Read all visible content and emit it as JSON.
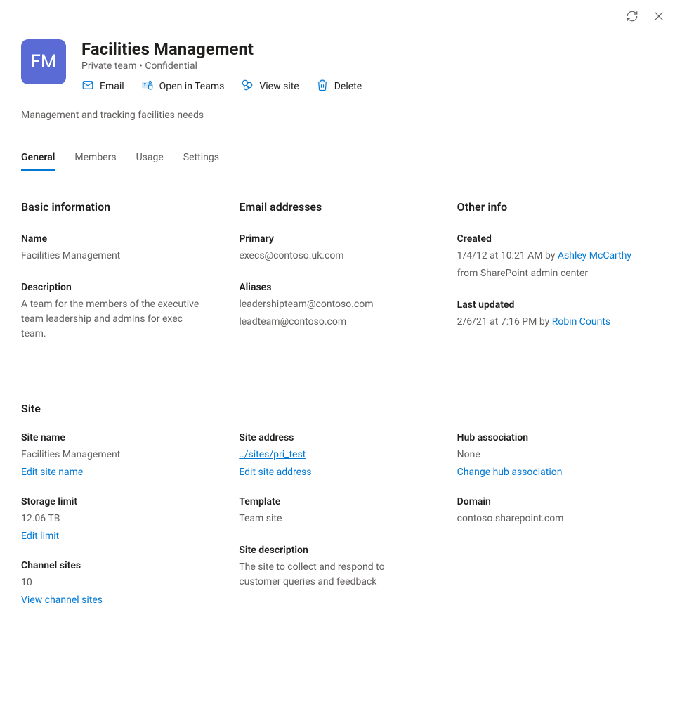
{
  "header": {
    "avatar_initials": "FM",
    "title": "Facilities Management",
    "subtitle": "Private team • Confidential",
    "actions": {
      "email": "Email",
      "open_in_teams": "Open in Teams",
      "view_site": "View site",
      "delete": "Delete"
    },
    "description": "Management and tracking facilities needs"
  },
  "tabs": [
    "General",
    "Members",
    "Usage",
    "Settings"
  ],
  "sections": {
    "basic": {
      "heading": "Basic information",
      "name_label": "Name",
      "name_value": "Facilities Management",
      "desc_label": "Description",
      "desc_value": "A team for the members of the executive team leadership and admins for exec team."
    },
    "email": {
      "heading": "Email addresses",
      "primary_label": "Primary",
      "primary_value": "execs@contoso.uk.com",
      "aliases_label": "Aliases",
      "alias1": "leadershipteam@contoso.com",
      "alias2": "leadteam@contoso.com"
    },
    "other": {
      "heading": "Other info",
      "created_label": "Created",
      "created_line1_before": "1/4/12 at 10:21 AM by ",
      "created_line1_link": "Ashley McCarthy",
      "created_line2": "from SharePoint admin center",
      "updated_label": "Last updated",
      "updated_before": "2/6/21 at 7:16 PM by ",
      "updated_link": "Robin Counts"
    }
  },
  "site": {
    "heading": "Site",
    "name_label": "Site name",
    "name_value": "Facilities Management",
    "name_edit": "Edit site name",
    "storage_label": "Storage limit",
    "storage_value": "12.06 TB",
    "storage_edit": "Edit limit",
    "channel_label": "Channel sites",
    "channel_value": "10",
    "channel_edit": "View channel sites",
    "address_label": "Site address",
    "address_value": "../sites/pri_test",
    "address_edit": "Edit site address",
    "template_label": "Template",
    "template_value": "Team site",
    "sitedesc_label": "Site description",
    "sitedesc_value": "The site to collect and respond to customer queries and feedback",
    "hub_label": "Hub association",
    "hub_value": "None",
    "hub_edit": "Change hub association",
    "domain_label": "Domain",
    "domain_value": "contoso.sharepoint.com"
  }
}
